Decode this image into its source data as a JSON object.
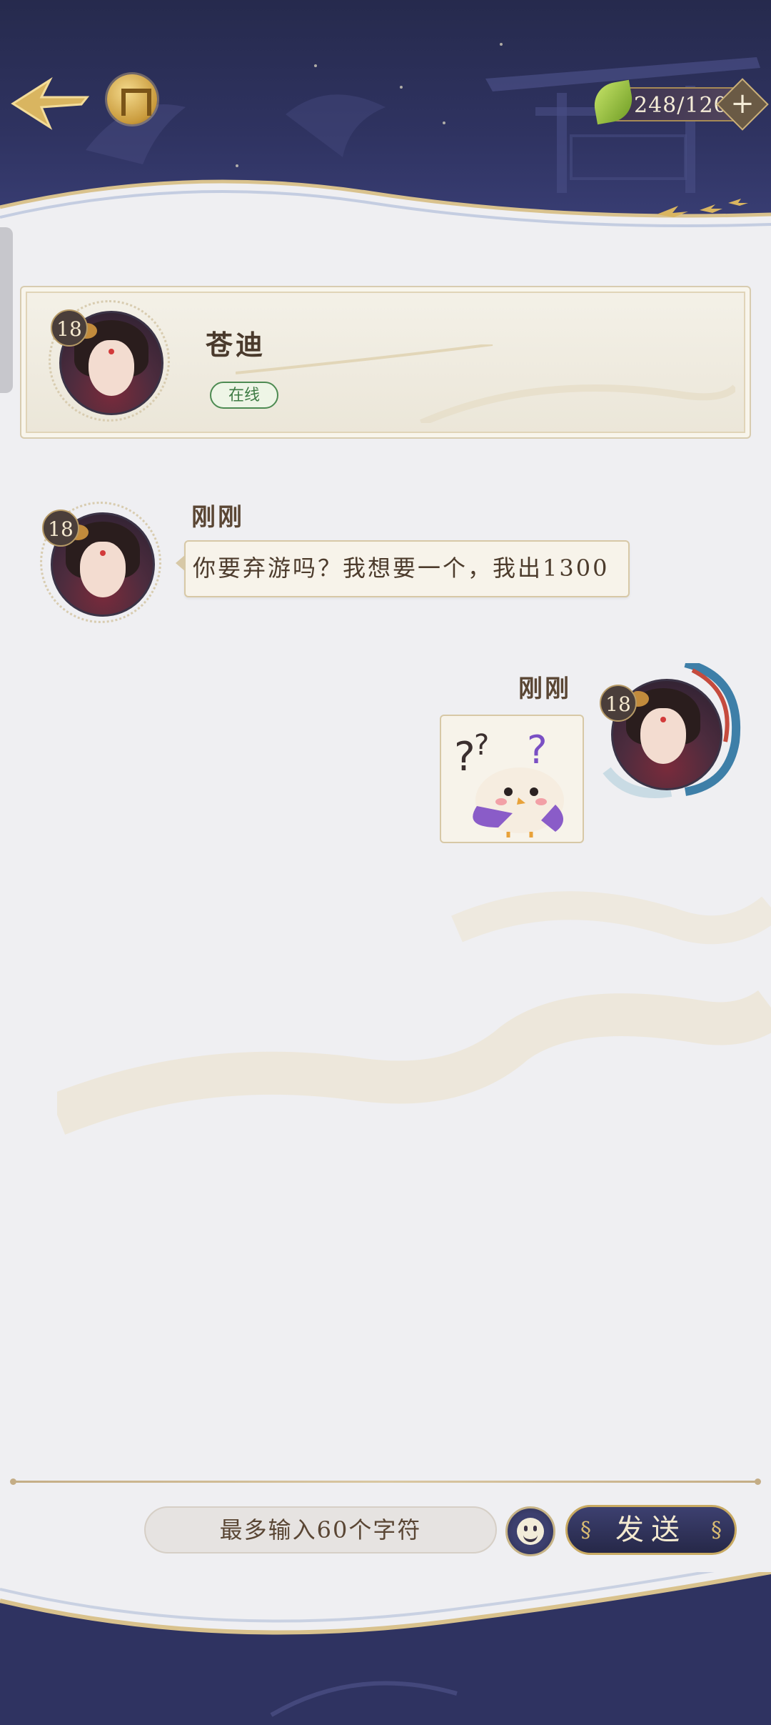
{
  "header": {
    "energy": "248/120",
    "energy_add_symbol": "+"
  },
  "contact": {
    "name": "苍迪",
    "level": "18",
    "status": "在线"
  },
  "messages": [
    {
      "time": "刚刚",
      "level": "18",
      "text": "你要弃游吗？我想要一个，我出1300"
    },
    {
      "time": "刚刚",
      "level": "18",
      "sticker": "confused-bird-sticker"
    }
  ],
  "input": {
    "placeholder": "最多输入60个字符",
    "send_label": "发送"
  },
  "colors": {
    "header_bg": "#2f3361",
    "card_border": "#d8ccb0",
    "text_brown": "#4c3b2c",
    "online_green": "#3d7a43",
    "gold_accent": "#c9aa62"
  }
}
